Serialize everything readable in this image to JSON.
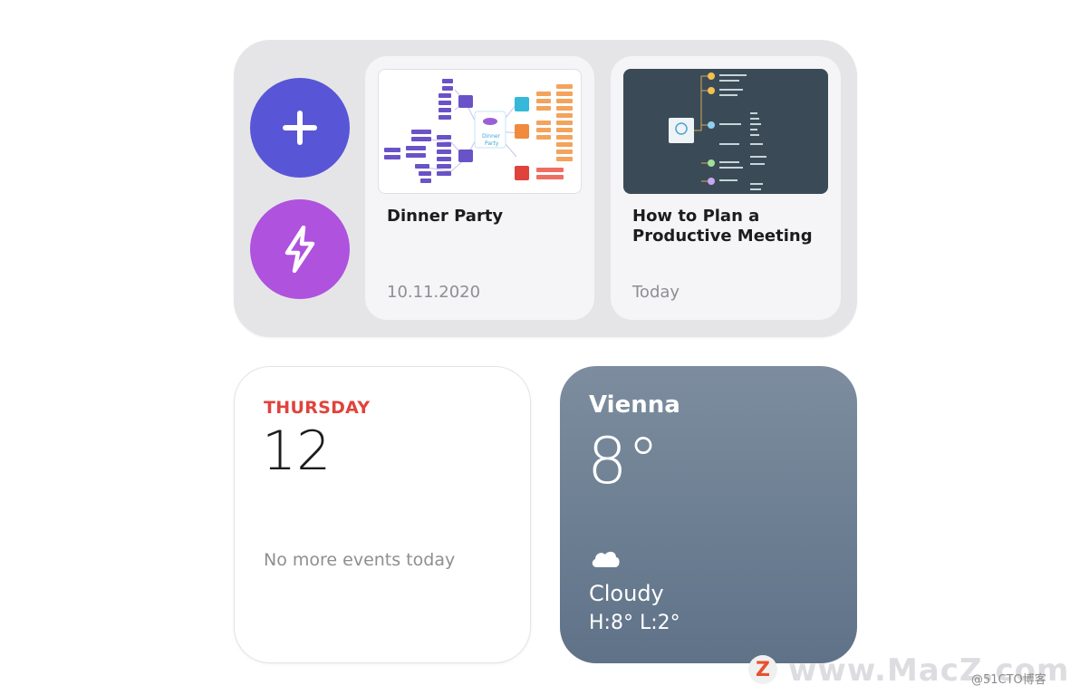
{
  "shortcuts": {
    "add_icon": "plus-icon",
    "quick_icon": "lightning-icon",
    "add_color": "#5856d6",
    "quick_color": "#af52de"
  },
  "recent_maps": [
    {
      "title": "Dinner Party",
      "date": "10.11.2020",
      "center_label": "Dinner\nParty"
    },
    {
      "title": "How to Plan a Productive Meeting",
      "date": "Today"
    }
  ],
  "calendar": {
    "weekday": "THURSDAY",
    "day": "12",
    "events_text": "No more events today",
    "accent": "#e0433b"
  },
  "weather": {
    "city": "Vienna",
    "temperature": "8°",
    "condition_icon": "cloud-icon",
    "condition": "Cloudy",
    "high_low": "H:8° L:2°"
  },
  "watermark": {
    "badge": "Z",
    "site": "www.MacZ.com",
    "blog": "@51CTO博客"
  }
}
